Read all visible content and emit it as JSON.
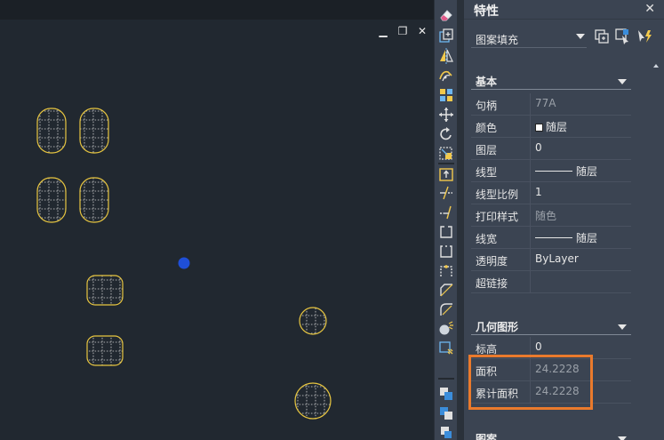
{
  "canvas": {
    "controls": {
      "minimize": "▁",
      "restore": "❐",
      "close": "✕"
    },
    "colors": {
      "background": "#212830",
      "hatch_outline": "#e8c640",
      "grip": "#1f4fd8"
    }
  },
  "toolbar": {
    "icons": [
      "eraser-icon",
      "copy-icon",
      "mirror-icon",
      "offset-icon",
      "array-icon",
      "move-icon",
      "rotate-icon",
      "scale-icon",
      "stretch-icon",
      "trim-icon",
      "extend-icon",
      "break-at-point-icon",
      "break-icon",
      "join-icon",
      "chamfer-icon",
      "fillet-icon",
      "blend-icon",
      "explode-icon",
      "draw-order-front-icon",
      "draw-order-back-icon",
      "draw-order-above-icon"
    ]
  },
  "panel": {
    "title": "特性",
    "close": "✕",
    "object_type": "图案填充",
    "sections": {
      "basic": {
        "label": "基本",
        "rows": [
          {
            "name": "句柄",
            "value": "77A",
            "dim": true
          },
          {
            "name": "颜色",
            "value": "随层"
          },
          {
            "name": "图层",
            "value": "0"
          },
          {
            "name": "线型",
            "value": "随层"
          },
          {
            "name": "线型比例",
            "value": "1"
          },
          {
            "name": "打印样式",
            "value": "随色",
            "dim": true
          },
          {
            "name": "线宽",
            "value": "随层"
          },
          {
            "name": "透明度",
            "value": "ByLayer"
          },
          {
            "name": "超链接",
            "value": ""
          }
        ]
      },
      "geometry": {
        "label": "几何图形",
        "rows": [
          {
            "name": "标高",
            "value": "0"
          },
          {
            "name": "面积",
            "value": "24.2228",
            "dim": true
          },
          {
            "name": "累计面积",
            "value": "24.2228",
            "dim": true
          }
        ]
      },
      "pattern": {
        "label": "图案"
      }
    },
    "colors": {
      "highlight": "#ea7a2c"
    }
  }
}
